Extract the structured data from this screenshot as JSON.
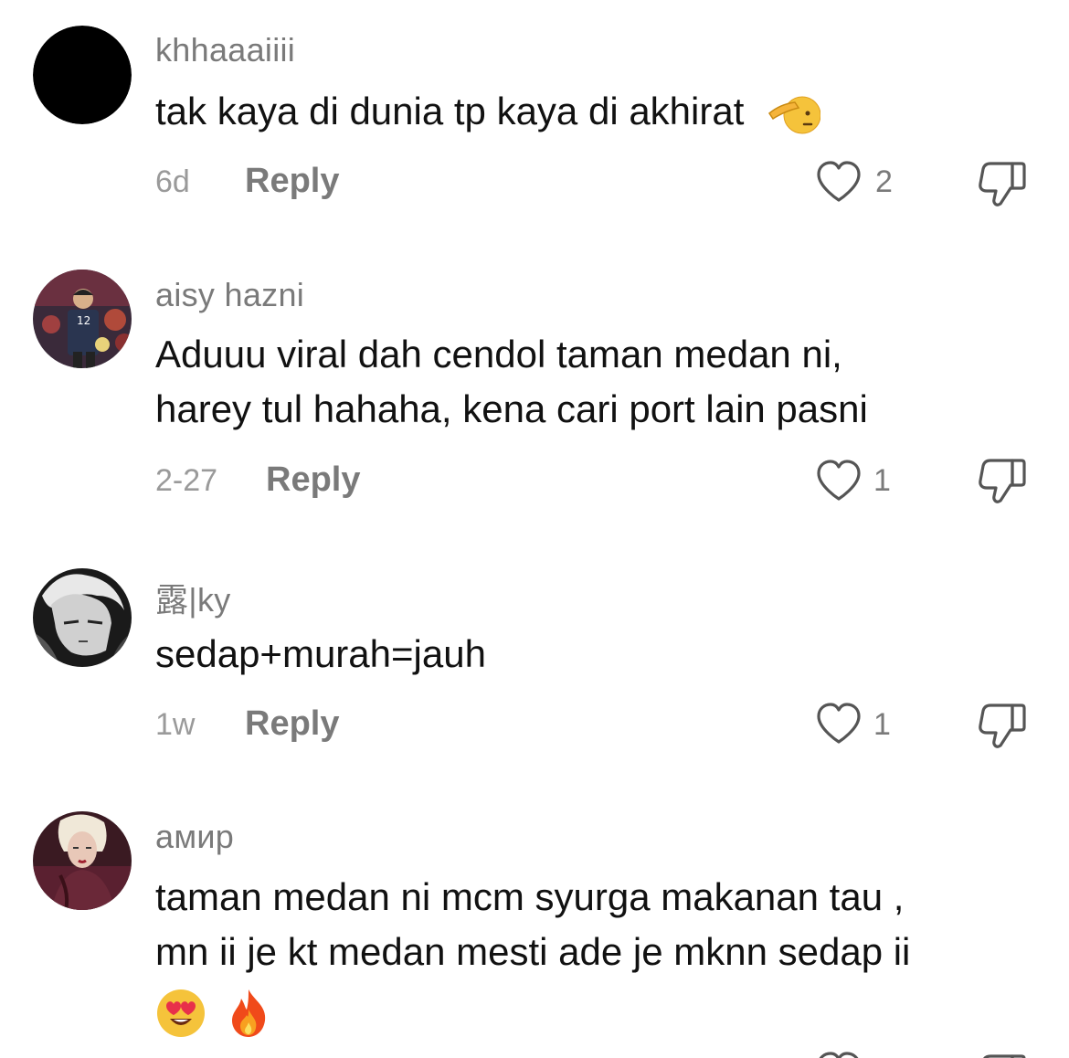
{
  "comments": [
    {
      "username": "khhaaaiiii",
      "text": "tak kaya di dunia tp kaya di akhirat",
      "time": "6d",
      "reply_label": "Reply",
      "likes": "2",
      "avatar_icon": "black-circle-avatar",
      "trailing_emoji": "saluting-face-emoji"
    },
    {
      "username": "aisy hazni",
      "text_line1": "Aduuu viral dah cendol taman medan ni,",
      "text_line2": "harey tul hahaha, kena cari port lain pasni",
      "time": "2-27",
      "reply_label": "Reply",
      "likes": "1",
      "avatar_icon": "volleyball-player-avatar"
    },
    {
      "username": "露|ky",
      "text": "sedap+murah=jauh",
      "time": "1w",
      "reply_label": "Reply",
      "likes": "1",
      "avatar_icon": "anime-character-avatar"
    },
    {
      "username": "амир",
      "text_line1": "taman medan ni mcm syurga makanan tau ,",
      "text_line2": "mn ii je kt medan mesti ade je mknn sedap ii",
      "avatar_icon": "woman-portrait-avatar",
      "trailing_emojis": [
        "heart-eyes-emoji",
        "fire-emoji"
      ]
    }
  ],
  "colors": {
    "username": "#7a7a7a",
    "text": "#111111",
    "meta": "#9a9a9a",
    "icon": "#555555"
  }
}
